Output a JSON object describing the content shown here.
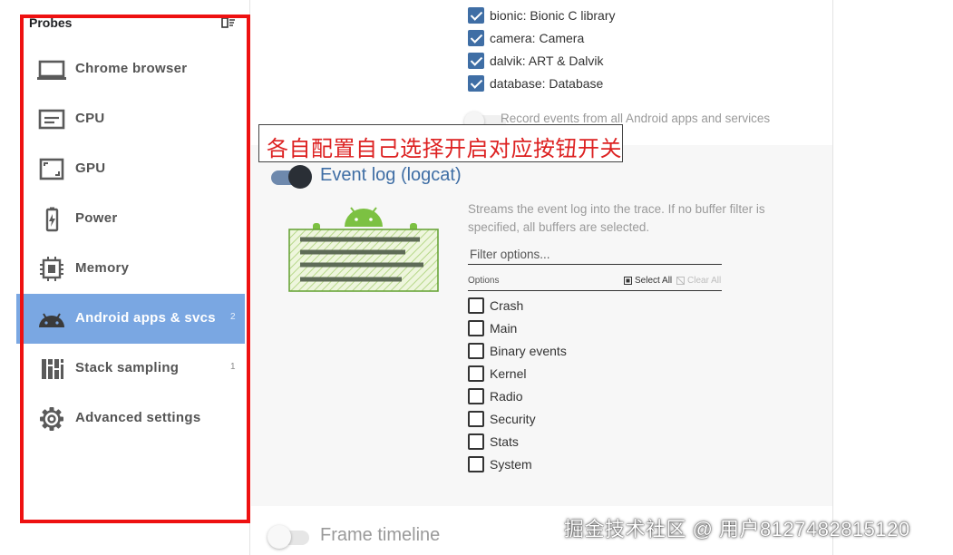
{
  "sidebar": {
    "title": "Probes",
    "items": [
      {
        "label": "Chrome browser",
        "icon": "laptop-icon",
        "count": ""
      },
      {
        "label": "CPU",
        "icon": "cpu-icon",
        "count": ""
      },
      {
        "label": "GPU",
        "icon": "gpu-icon",
        "count": ""
      },
      {
        "label": "Power",
        "icon": "battery-icon",
        "count": ""
      },
      {
        "label": "Memory",
        "icon": "memory-chip-icon",
        "count": ""
      },
      {
        "label": "Android apps & svcs",
        "icon": "android-icon",
        "count": "2",
        "active": true
      },
      {
        "label": "Stack sampling",
        "icon": "stack-sampling-icon",
        "count": "1"
      },
      {
        "label": "Advanced settings",
        "icon": "gear-icon",
        "count": ""
      }
    ]
  },
  "atrace_categories": [
    {
      "label": "bionic: Bionic C library",
      "checked": true
    },
    {
      "label": "camera: Camera",
      "checked": true
    },
    {
      "label": "dalvik: ART & Dalvik",
      "checked": true
    },
    {
      "label": "database: Database",
      "checked": true
    }
  ],
  "record_all_apps": {
    "label": "Record events from all Android apps and services",
    "enabled": false
  },
  "callout": {
    "text": "各自配置自己选择开启对应按钮开关"
  },
  "event_log": {
    "title": "Event log (logcat)",
    "enabled": true,
    "description": "Streams the event log into the trace. If no buffer filter is specified, all buffers are selected.",
    "filter_placeholder": "Filter options...",
    "options_label": "Options",
    "select_all": "Select All",
    "clear_all": "Clear All",
    "buffers": [
      {
        "label": "Crash",
        "checked": false
      },
      {
        "label": "Main",
        "checked": false
      },
      {
        "label": "Binary events",
        "checked": false
      },
      {
        "label": "Kernel",
        "checked": false
      },
      {
        "label": "Radio",
        "checked": false
      },
      {
        "label": "Security",
        "checked": false
      },
      {
        "label": "Stats",
        "checked": false
      },
      {
        "label": "System",
        "checked": false
      }
    ]
  },
  "frame_timeline": {
    "title": "Frame timeline",
    "enabled": false
  },
  "watermark": {
    "text": "掘金技术社区 @ 用户8127482815120"
  },
  "colors": {
    "accent": "#3f6ea5",
    "active_nav": "#7aa7e2",
    "highlight_box": "#ee1111",
    "callout_text": "#dd2222"
  }
}
